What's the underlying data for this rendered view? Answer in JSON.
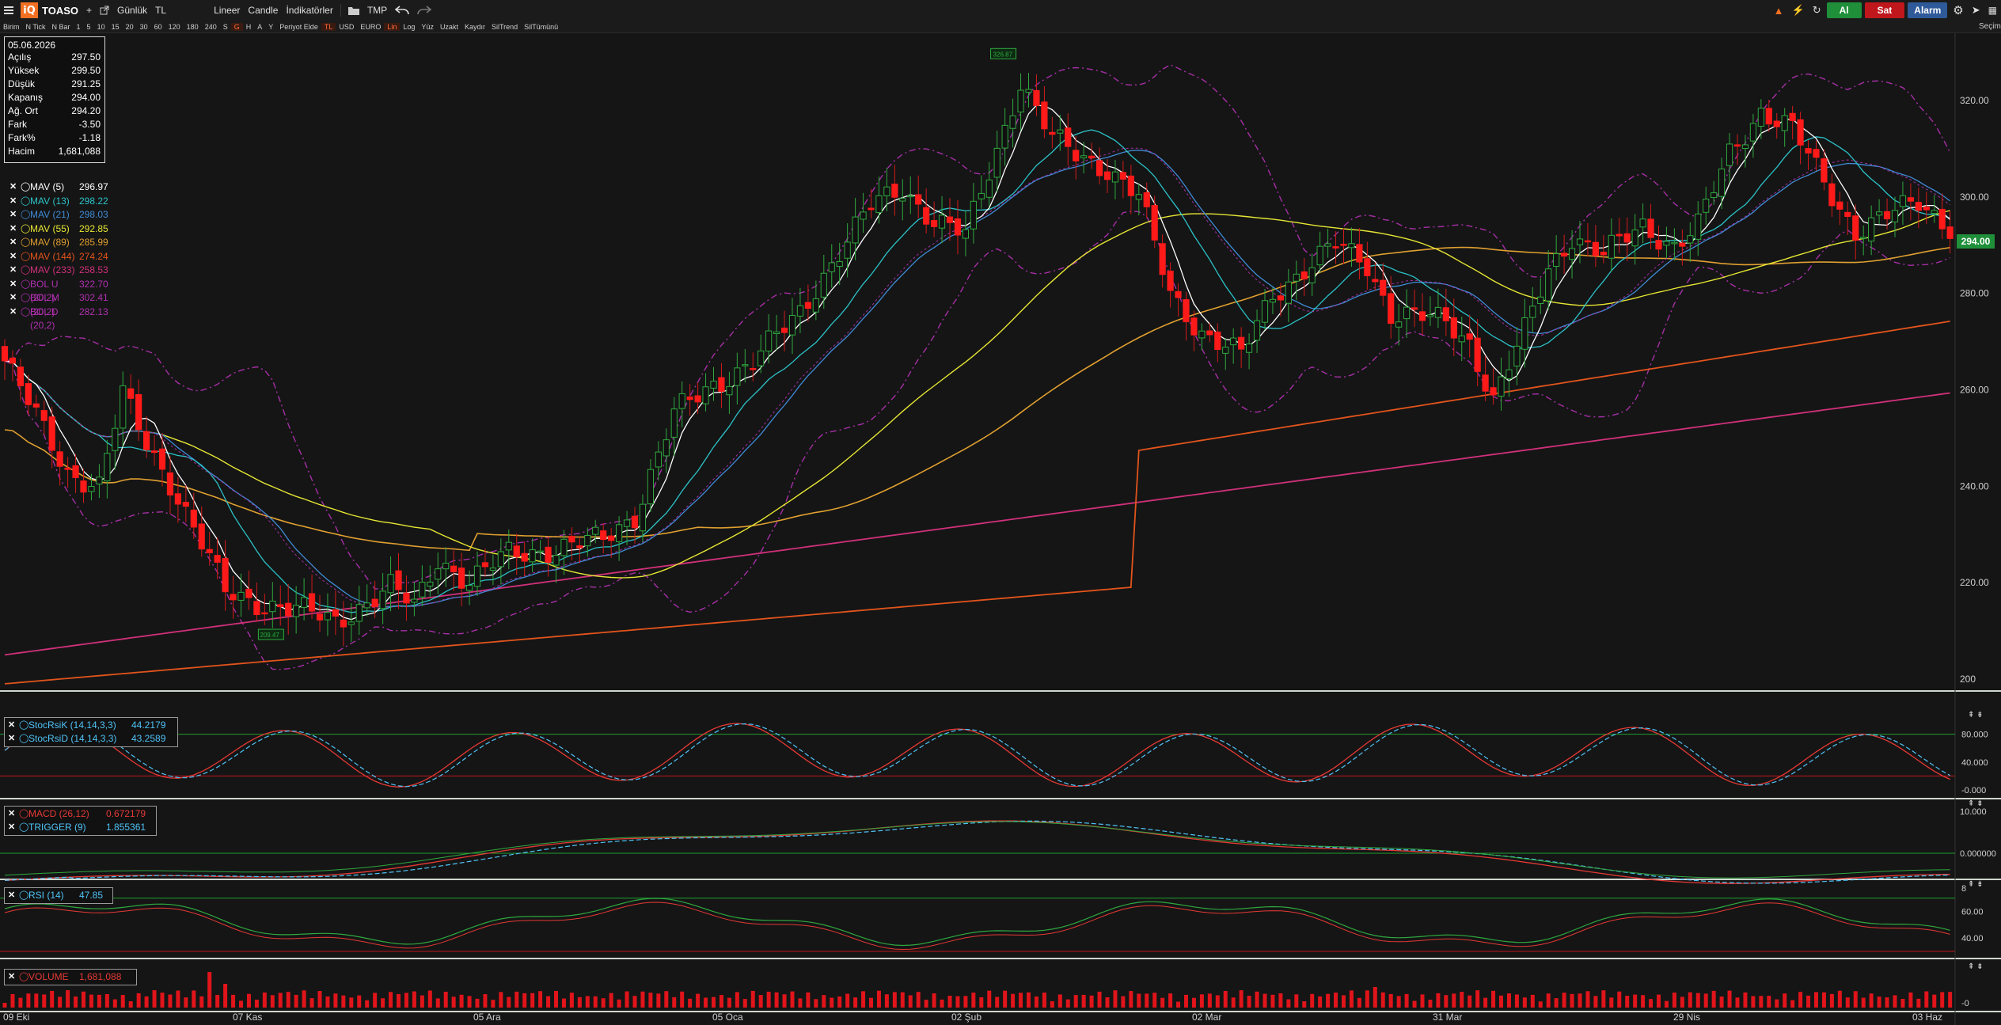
{
  "toolbar": {
    "logo": "iQ",
    "symbol": "TOASO",
    "plus": "+",
    "period": "Günlük",
    "currency": "TL",
    "scale": "Lineer",
    "chart_type": "Candle",
    "indicators": "İndikatörler",
    "tmp": "TMP",
    "buy": "Al",
    "sell": "Sat",
    "alarm": "Alarm",
    "right_edge": "Seçim"
  },
  "subbar": [
    "Birim",
    "N Tick",
    "N Bar",
    "1",
    "5",
    "10",
    "15",
    "20",
    "30",
    "60",
    "120",
    "180",
    "240",
    "S",
    "G",
    "H",
    "A",
    "Y",
    "Periyot Elde",
    "TL",
    "USD",
    "EURO",
    "Lin",
    "Log",
    "Yüz",
    "Uzakt",
    "Kaydır",
    "SilTrend",
    "SilTümünü"
  ],
  "subbar_active": [
    "G",
    "Lin",
    "TL"
  ],
  "infobox": {
    "date": "05.06.2026",
    "rows": [
      {
        "label": "Açılış",
        "value": "297.50"
      },
      {
        "label": "Yüksek",
        "value": "299.50"
      },
      {
        "label": "Düşük",
        "value": "291.25"
      },
      {
        "label": "Kapanış",
        "value": "294.00"
      },
      {
        "label": "Ağ. Ort",
        "value": "294.20"
      },
      {
        "label": "Fark",
        "value": "-3.50"
      },
      {
        "label": "Fark%",
        "value": "-1.18"
      },
      {
        "label": "Hacim",
        "value": "1,681,088"
      }
    ]
  },
  "legend": [
    {
      "name": "MAV (5)",
      "value": "296.97",
      "color": "#ffffff"
    },
    {
      "name": "MAV (13)",
      "value": "298.22",
      "color": "#2cc3c9"
    },
    {
      "name": "MAV (21)",
      "value": "298.03",
      "color": "#3f8bd6"
    },
    {
      "name": "MAV (55)",
      "value": "292.85",
      "color": "#e6e635"
    },
    {
      "name": "MAV (89)",
      "value": "285.99",
      "color": "#e0a030"
    },
    {
      "name": "MAV (144)",
      "value": "274.24",
      "color": "#e2541c"
    },
    {
      "name": "MAV (233)",
      "value": "258.53",
      "color": "#d0307a"
    },
    {
      "name": "BOL U (20,2)",
      "value": "322.70",
      "color": "#b030b0"
    },
    {
      "name": "BOL M (20,2)",
      "value": "302.41",
      "color": "#b030b0"
    },
    {
      "name": "BOL D (20,2)",
      "value": "282.13",
      "color": "#b030b0"
    }
  ],
  "price_tag": "294.00",
  "high_marker": "326.87",
  "low_marker": "209.47",
  "stoch_legend": [
    {
      "name": "StocRsiK (14,14,3,3)",
      "value": "44.2179",
      "color": "#4fc3f7"
    },
    {
      "name": "StocRsiD (14,14,3,3)",
      "value": "43.2589",
      "color": "#4fc3f7"
    }
  ],
  "macd_legend": [
    {
      "name": "MACD (26,12)",
      "value": "0.672179",
      "color": "#e53935"
    },
    {
      "name": "TRIGGER (9)",
      "value": "1.855361",
      "color": "#4fc3f7"
    }
  ],
  "rsi_legend": [
    {
      "name": "RSI (14)",
      "value": "47.85",
      "color": "#4fc3f7"
    }
  ],
  "volume_legend": [
    {
      "name": "VOLUME",
      "value": "1,681,088",
      "color": "#e53935"
    }
  ],
  "chart_data": {
    "type": "candlestick",
    "title": "TOASO",
    "x_labels": [
      "09 Eki",
      "07 Kas",
      "05 Ara",
      "05 Oca",
      "02 Şub",
      "02 Mar",
      "31 Mar",
      "29 Nis",
      "03 Haz"
    ],
    "y_ticks": [
      "320.00",
      "300.00",
      "280.00",
      "260.00",
      "240.00",
      "220.00",
      "200"
    ],
    "ylim": [
      198,
      333
    ],
    "close_anchors": [
      [
        0,
        266
      ],
      [
        8,
        243
      ],
      [
        12,
        240
      ],
      [
        15,
        259
      ],
      [
        18,
        249
      ],
      [
        21,
        241
      ],
      [
        25,
        228
      ],
      [
        28,
        218
      ],
      [
        32,
        216
      ],
      [
        38,
        214
      ],
      [
        42,
        212
      ],
      [
        46,
        216
      ],
      [
        49,
        219
      ],
      [
        52,
        215
      ],
      [
        55,
        225
      ],
      [
        59,
        220
      ],
      [
        64,
        226
      ],
      [
        70,
        227
      ],
      [
        76,
        229
      ],
      [
        80,
        234
      ],
      [
        85,
        255
      ],
      [
        90,
        261
      ],
      [
        95,
        266
      ],
      [
        101,
        276
      ],
      [
        104,
        284
      ],
      [
        110,
        298
      ],
      [
        114,
        302
      ],
      [
        118,
        295
      ],
      [
        122,
        292
      ],
      [
        126,
        310
      ],
      [
        129,
        324
      ],
      [
        133,
        312
      ],
      [
        136,
        309
      ],
      [
        140,
        306
      ],
      [
        144,
        300
      ],
      [
        148,
        280
      ],
      [
        152,
        272
      ],
      [
        157,
        267
      ],
      [
        161,
        280
      ],
      [
        165,
        285
      ],
      [
        169,
        290
      ],
      [
        173,
        286
      ],
      [
        176,
        276
      ],
      [
        180,
        275
      ],
      [
        183,
        274
      ],
      [
        186,
        270
      ],
      [
        189,
        258
      ],
      [
        193,
        272
      ],
      [
        196,
        285
      ],
      [
        199,
        292
      ],
      [
        203,
        288
      ],
      [
        208,
        294
      ],
      [
        212,
        290
      ],
      [
        215,
        294
      ],
      [
        219,
        309
      ],
      [
        223,
        318
      ],
      [
        227,
        314
      ],
      [
        231,
        303
      ],
      [
        235,
        293
      ],
      [
        239,
        296
      ],
      [
        243,
        299
      ],
      [
        247,
        294
      ]
    ],
    "stoch_ylim": [
      0,
      100
    ],
    "stoch_levels": [
      "80.000",
      "40.000",
      "-0.000"
    ],
    "macd_levels": [
      "10.000",
      "0.000000"
    ],
    "rsi_levels": [
      "8",
      "60.00",
      "40.00"
    ],
    "volume_levels": [
      "-0"
    ]
  }
}
